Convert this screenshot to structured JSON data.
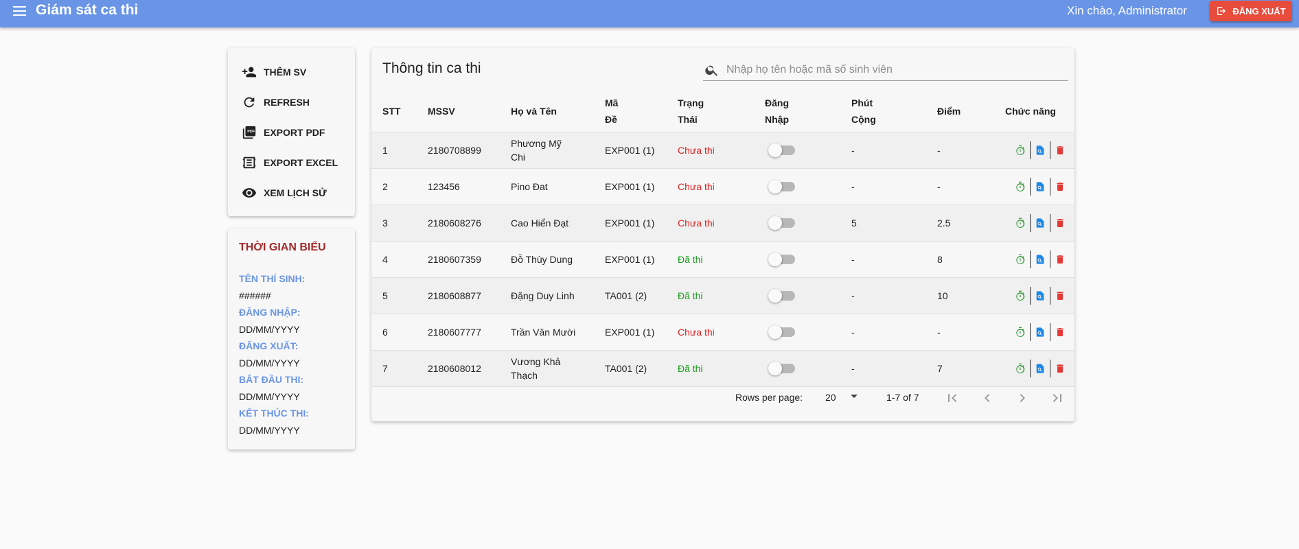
{
  "appbar": {
    "title": "Giám sát ca thi",
    "greeting": "Xin chào, Administrator",
    "logout_label": "ĐĂNG XUẤT",
    "color": "#6a95e6"
  },
  "sidebar": {
    "actions": [
      {
        "label": "THÊM SV",
        "icon": "person-add-icon"
      },
      {
        "label": "REFRESH",
        "icon": "refresh-icon"
      },
      {
        "label": "EXPORT PDF",
        "icon": "pdf-icon"
      },
      {
        "label": "EXPORT EXCEL",
        "icon": "excel-icon"
      },
      {
        "label": "XEM LỊCH SỬ",
        "icon": "eye-icon"
      }
    ],
    "schedule": {
      "title": "THỜI GIAN BIỂU",
      "candidate_label": "TÊN THÍ SINH:",
      "candidate_value": "######",
      "login_label": "ĐĂNG NHẬP:",
      "login_value": "DD/MM/YYYY",
      "logout_label": "ĐĂNG XUẤT:",
      "logout_value": "DD/MM/YYYY",
      "start_label": "BẮT ĐẦU THI:",
      "start_value": "DD/MM/YYYY",
      "end_label": "KẾT THÚC THI:",
      "end_value": "DD/MM/YYYY"
    }
  },
  "main": {
    "title": "Thông tin ca thi",
    "search_placeholder": "Nhập họ tên hoặc mã số sinh viên",
    "columns": {
      "stt": "STT",
      "mssv": "MSSV",
      "name": "Họ và Tên",
      "code_1": "Mã",
      "code_2": "Đề",
      "status_1": "Trạng",
      "status_2": "Thái",
      "login_1": "Đăng",
      "login_2": "Nhập",
      "extra_1": "Phút",
      "extra_2": "Cộng",
      "score": "Điểm",
      "functions": "Chức năng"
    },
    "rows": [
      {
        "stt": "1",
        "mssv": "2180708899",
        "name": "Phương Mỹ Chi",
        "code": "EXP001 (1)",
        "status": "Chưa thi",
        "status_type": "pending",
        "login": false,
        "extra": "-",
        "score": "-"
      },
      {
        "stt": "2",
        "mssv": "123456",
        "name": "Pino Đat",
        "code": "EXP001 (1)",
        "status": "Chưa thi",
        "status_type": "pending",
        "login": false,
        "extra": "-",
        "score": "-"
      },
      {
        "stt": "3",
        "mssv": "2180608276",
        "name": "Cao Hiển Đạt",
        "code": "EXP001 (1)",
        "status": "Chưa thi",
        "status_type": "pending",
        "login": false,
        "extra": "5",
        "score": "2.5"
      },
      {
        "stt": "4",
        "mssv": "2180607359",
        "name": "Đỗ Thùy Dung",
        "code": "EXP001 (1)",
        "status": "Đã thi",
        "status_type": "done",
        "login": false,
        "extra": "-",
        "score": "8"
      },
      {
        "stt": "5",
        "mssv": "2180608877",
        "name": "Đặng Duy Linh",
        "code": "TA001 (2)",
        "status": "Đã thi",
        "status_type": "done",
        "login": false,
        "extra": "-",
        "score": "10"
      },
      {
        "stt": "6",
        "mssv": "2180607777",
        "name": "Trần Văn Mười",
        "code": "EXP001 (1)",
        "status": "Chưa thi",
        "status_type": "pending",
        "login": false,
        "extra": "-",
        "score": "-"
      },
      {
        "stt": "7",
        "mssv": "2180608012",
        "name": "Vương Khả Thạch",
        "code": "TA001 (2)",
        "status": "Đã thi",
        "status_type": "done",
        "login": false,
        "extra": "-",
        "score": "7"
      }
    ],
    "pagination": {
      "rows_per_page_label": "Rows per page:",
      "rows_per_page": "20",
      "range": "1-7 of 7"
    }
  },
  "colors": {
    "pending": "#e02020",
    "done": "#1a9b1a",
    "timer": "#43a047",
    "view": "#1e88e5",
    "delete": "#e53935",
    "logout_button": "#e74c3c"
  }
}
